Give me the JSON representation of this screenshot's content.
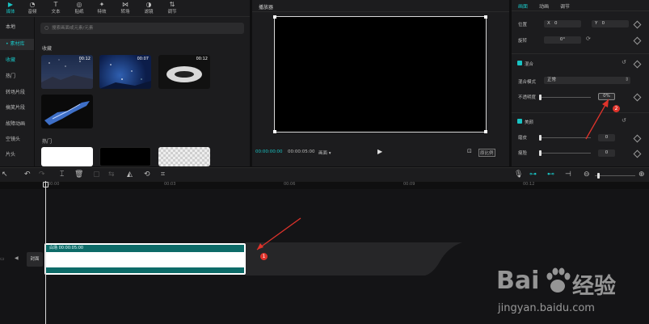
{
  "top_toolbar": {
    "tools": [
      {
        "label": "媒体",
        "icon": "▶",
        "active": true
      },
      {
        "label": "音频",
        "icon": "◔"
      },
      {
        "label": "文本",
        "icon": "T"
      },
      {
        "label": "贴纸",
        "icon": "◎"
      },
      {
        "label": "特效",
        "icon": "✦"
      },
      {
        "label": "转场",
        "icon": "⋈"
      },
      {
        "label": "滤镜",
        "icon": "◑"
      },
      {
        "label": "调节",
        "icon": "⇅"
      }
    ]
  },
  "left_nav": {
    "items": [
      {
        "label": "本地"
      },
      {
        "label": "• 素材库",
        "active": true
      },
      {
        "label": "收藏",
        "active": true
      },
      {
        "label": "热门"
      },
      {
        "label": "转场片段"
      },
      {
        "label": "搞笑片段"
      },
      {
        "label": "故障动画"
      },
      {
        "label": "空镜头"
      },
      {
        "label": "片头"
      }
    ]
  },
  "media": {
    "search_placeholder": "搜索画面或元素/元素",
    "section_favorites": "收藏",
    "section_hot": "热门",
    "thumbs": [
      {
        "duration": "00:12"
      },
      {
        "duration": "00:07"
      },
      {
        "duration": "00:12"
      },
      {
        "duration": ""
      }
    ]
  },
  "player": {
    "title": "播放器",
    "current_time": "00:00:00:00",
    "total_time": "00:00:05:00",
    "mode": "画面 ▾",
    "ratio_label": "原比例"
  },
  "props": {
    "tabs": [
      "画面",
      "动画",
      "调节"
    ],
    "position_label": "位置",
    "x_label": "X",
    "x_value": "0",
    "y_label": "Y",
    "y_value": "0",
    "rotation_label": "旋转",
    "rotation_value": "0°",
    "blend_title": "混合",
    "blend_mode_label": "混合模式",
    "blend_mode_value": "正常",
    "opacity_label": "不透明度",
    "opacity_value": "0%",
    "beauty_title": "美颜",
    "smooth_label": "磨皮",
    "smooth_value": "0",
    "thin_label": "瘦脸",
    "thin_value": "0"
  },
  "timeline": {
    "ticks": [
      "00:00",
      "00:03",
      "00:06",
      "00:09",
      "00:12"
    ],
    "clip_label": "白场  00:00:05:00",
    "cover_label": "封面"
  },
  "badges": [
    "1",
    "2"
  ],
  "watermark": {
    "brand": "Bai",
    "brand2": "经验",
    "url": "jingyan.baidu.com"
  },
  "colors": {
    "accent": "#19c3c3",
    "clip": "#0d6b68",
    "badge": "#e0332b",
    "arrow": "#e0332b"
  }
}
